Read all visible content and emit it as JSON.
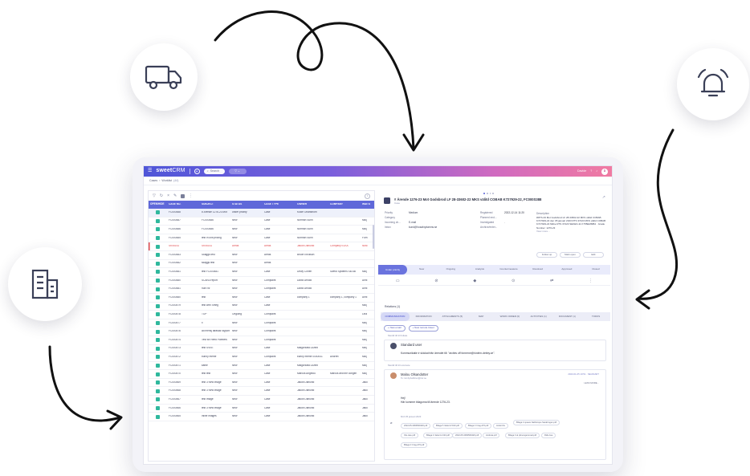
{
  "colors": {
    "accent": "#5f68d9",
    "status_green": "#2fb89d",
    "overdue_red": "#e0484c",
    "header_gradient": [
      "#4f56d8",
      "#d06ac0",
      "#f07aa2"
    ]
  },
  "decor_icons": [
    "truck-icon",
    "bell-icon",
    "building-icon"
  ],
  "topbar": {
    "brand_bold": "sweet",
    "brand_thin": "CRM",
    "search_placeholder": "Search",
    "filter_label": "▽ ⌄",
    "user_label": "Davide",
    "avatar_initials": "D"
  },
  "breadcrumb": {
    "root": "Cases",
    "sep": "›",
    "current": "Worklist",
    "count": "(44)"
  },
  "table": {
    "headers": [
      "OPEN/HIDE",
      "CASE NO.",
      "SUBJECT",
      "STATUS",
      "CASE TYPE",
      "OWNER",
      "COMPANY",
      "WAITS"
    ],
    "rows": [
      [
        "",
        "FC000488",
        "# Ärende 1276-23 Mot",
        "under priority",
        "Case",
        "Kuwe Ohanstrom",
        "",
        ""
      ],
      [
        "",
        "FC000487",
        "FC000486",
        "New",
        "Case",
        "Norman Sunn",
        "",
        "Mikj"
      ],
      [
        "",
        "FC000486",
        "FC000486",
        "New",
        "Case",
        "Norman Sunn",
        "",
        "Mikj"
      ],
      [
        "",
        "FC000485",
        "test in unit pricing",
        "New",
        "Case",
        "Norman Sunn",
        "",
        "Forn"
      ],
      [
        "",
        "SK06161",
        "SK06161",
        "Areas",
        "Areas",
        "Jakob Dahlund",
        "Company ELKA",
        "Nost"
      ],
      [
        "",
        "FC000483",
        "Skaggs test",
        "New",
        "Areas",
        "Bruce Erickson",
        "",
        ""
      ],
      [
        "",
        "FC000482",
        "skaggs test",
        "New",
        "Areas",
        "",
        "",
        ""
      ],
      [
        "",
        "FC000481",
        "test FC000481",
        "New",
        "Case",
        "Dewy Cohen",
        "Swedi Systems SB AB",
        "Mikj"
      ],
      [
        "",
        "FC000480",
        "SCAN3 report",
        "New",
        "Complaint",
        "David Arnold",
        "",
        "Anni"
      ],
      [
        "",
        "FC000481",
        "hurz hz",
        "New",
        "Complaint",
        "David Arnold",
        "",
        "Anni"
      ],
      [
        "",
        "FC000480",
        "test",
        "New",
        "Case",
        "company 1",
        "company 1, company 1",
        "Anni"
      ],
      [
        "",
        "FC000479",
        "test with Smeg",
        "New",
        "Case",
        "",
        "",
        "Mikj"
      ],
      [
        "",
        "FC000478",
        "TOP",
        "Ongoing",
        "Complaint",
        "",
        "",
        "Lina"
      ],
      [
        "",
        "FC000477",
        "x",
        "New",
        "Complaint",
        "",
        "",
        "Mikj"
      ],
      [
        "",
        "FC000476",
        "ad mensj atrasas rayport",
        "New",
        "Complaint",
        "",
        "",
        "Mikj"
      ],
      [
        "",
        "FC000474",
        "Test for Reed Partners",
        "New",
        "Complaint",
        "",
        "",
        "Mikj"
      ],
      [
        "",
        "FC000473",
        "test SVEE",
        "New",
        "Case",
        "Malgorzata Lozinb",
        "",
        "Mikj"
      ],
      [
        "",
        "FC000472",
        "bunny meme",
        "New",
        "Complaint",
        "bunny meme 0000041",
        "Andrret",
        "Mikj"
      ],
      [
        "",
        "FC000471",
        "kartie",
        "New",
        "Case",
        "Malgorzata Lozinb",
        "",
        "Mikj"
      ],
      [
        "",
        "FC000470",
        "test test",
        "New",
        "Case",
        "Marcus Angelou",
        "Marcus and the congen",
        "Mikj"
      ],
      [
        "",
        "FC000469",
        "test 3 New image",
        "New",
        "Case",
        "Jakob Dahlund",
        "",
        "Jako"
      ],
      [
        "",
        "FC000468",
        "test 3 New image",
        "New",
        "Case",
        "Jakob Dahlund",
        "",
        "Jako"
      ],
      [
        "",
        "FC000467",
        "test image",
        "New",
        "Case",
        "Jakob Dahlund",
        "",
        "Jako"
      ],
      [
        "",
        "FC000466",
        "test 3 New image",
        "New",
        "Case",
        "Jakob Dahlund",
        "",
        "Jako"
      ],
      [
        "",
        "FC000465",
        "inline images",
        "New",
        "Case",
        "Jakob Dahlund",
        "",
        "Jako"
      ]
    ]
  },
  "detail": {
    "title": "# Ärende 1276-23 Mot Godsbrod LF 28-33602-22 MKS välitd COBAB K727929-22, FC000S388",
    "subtitle": "Case",
    "fields": [
      [
        "Priority",
        "Medium"
      ],
      [
        "Category",
        ""
      ],
      [
        "Incoming ch...",
        "E-mail"
      ],
      [
        "Inbox",
        "kund@hosabrydamns.se"
      ]
    ],
    "fields2": [
      [
        "Registered",
        "2022-12-14 11:20"
      ],
      [
        "Planned end...",
        ""
      ],
      [
        "Investigated",
        "."
      ],
      [
        "Archive/enter...",
        ""
      ]
    ],
    "description_label": "Description",
    "description": "#RTS-33 Mot Godsbrod LF 28-33602-22 MKS välitd COBAB K727929-22 den 05 januari 2023 RTS 37223 MKS välitd COBAB K727929-22 Mkbe RTS 37223 SEKEN-11 K755EMMB4 · Grade Number: 1276-23",
    "view_more": "View more...",
    "buttons": [
      "Follow up",
      "Mark open",
      "Edit"
    ],
    "steps": [
      "Under priority",
      "New",
      "Ongoing",
      "Analysis",
      "Countermeasure",
      "Resolved",
      "Approved",
      "Closed"
    ],
    "actions": [
      "▭",
      "⊘",
      "◆",
      "⊙",
      "⇄",
      "⋮"
    ],
    "related_head": "Relations (1)",
    "subtabs": [
      "COMMUNICATION",
      "INFORMATION",
      "ATTACHMENTS (5)",
      "MAP",
      "WORK ORDER (0)",
      "ACTIVITIES (1)",
      "DOCUMENT (1)",
      "TODOS"
    ],
    "new_btns": [
      "+ New email",
      "+ New remote travel"
    ],
    "sect1": "Meddl till till foliate",
    "card1_who": "Standard user",
    "card1_text": "Kommunikatie ir skickat frän ärendet till: \"arcites off fornerne@rivdrim-debby.ce\".",
    "sect2": "Meddl till till oculoste",
    "card2_who": "Malou Olsandotter",
    "card2_email": "To: kimbyhaftitruc@rwr.se",
    "card2_date": "2023-01-05 10:51 · NEUKIART",
    "card2_less": "LESS MORE...",
    "card2_hej": "Hej!",
    "card2_body": "Här kommer bilagorna till ärende 1276-23.",
    "card2_mvh": "Mvh 05 januari 2023",
    "attachments": [
      "2022-05-3060560420.pdf",
      "Bilaga 5 Vatterni 5/23.pdf",
      "Bilaga 3 Crag-270.pdf",
      "Ander.tfw",
      "Bilaga 2 speare Nathstrope Sarabrogen.pdf",
      "Ole.cate.pdf",
      "Bilaga 4 Vatterni 2/23.pdf",
      "2022-05-3060560420.pdf",
      "Andreta.pdf",
      "Bilaga 3 al plimengersroad.pdf",
      "Ride Ase",
      "Bilaga 3 Crag-270.pdf"
    ]
  }
}
